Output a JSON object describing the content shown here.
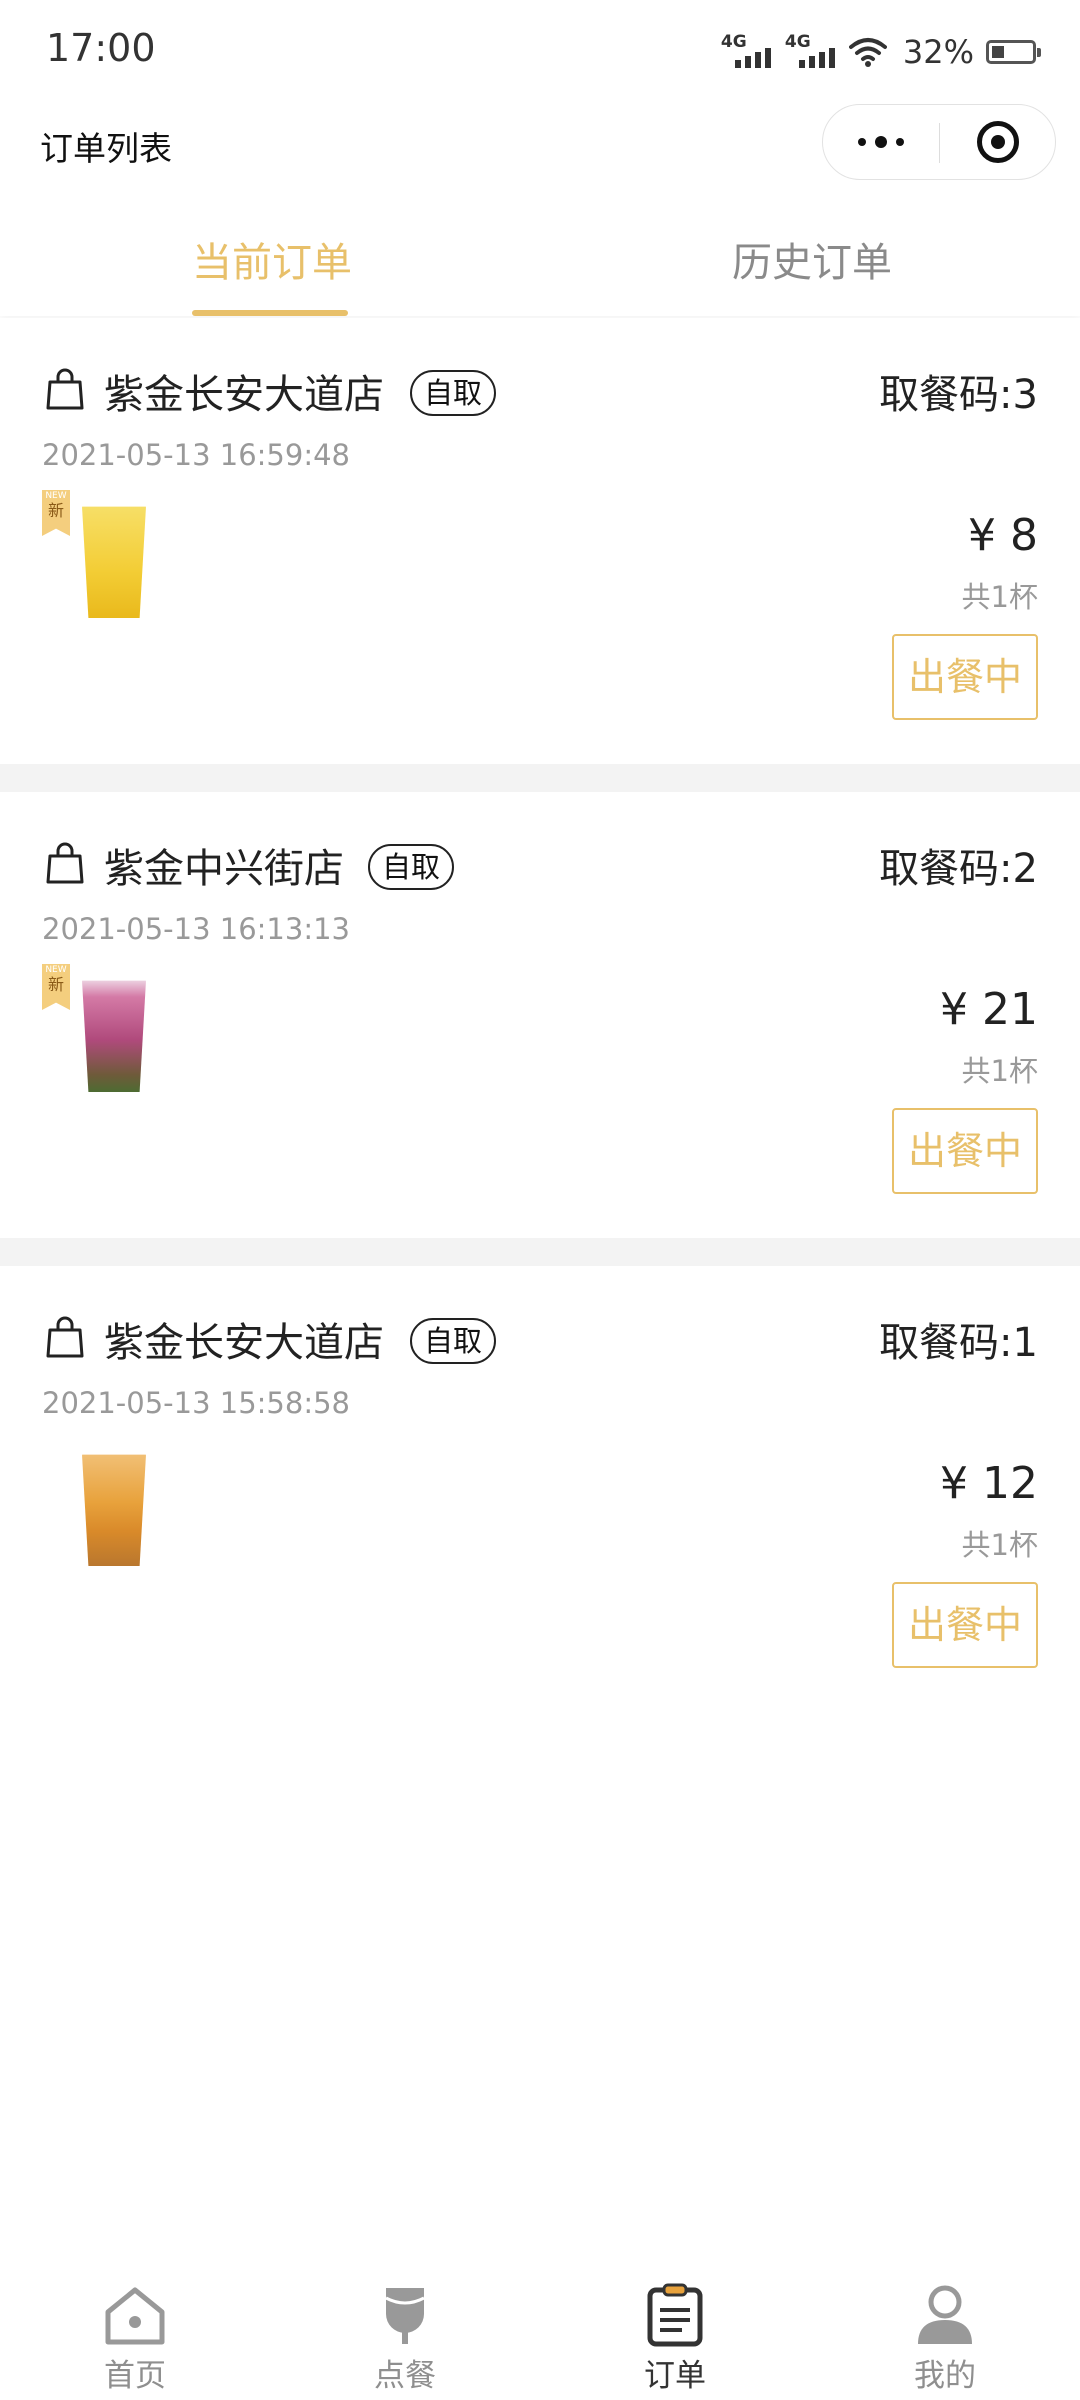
{
  "status_bar": {
    "time": "17:00",
    "signal_1": "4G",
    "signal_2": "4G",
    "battery": "32%",
    "battery_level": 0.32
  },
  "nav": {
    "title": "订单列表"
  },
  "tabs": [
    {
      "label": "当前订单",
      "active": true
    },
    {
      "label": "历史订单",
      "active": false
    }
  ],
  "orders": [
    {
      "store": "紫金长安大道店",
      "badge": "自取",
      "pickup_code": "取餐码:3",
      "time": "2021-05-13 16:59:48",
      "new_tag": "新",
      "price": "¥ 8",
      "count": "共1杯",
      "status": "出餐中",
      "drink_color": "#f3cd35"
    },
    {
      "store": "紫金中兴街店",
      "badge": "自取",
      "pickup_code": "取餐码:2",
      "time": "2021-05-13 16:13:13",
      "new_tag": "新",
      "price": "¥ 21",
      "count": "共1杯",
      "status": "出餐中",
      "drink_color": "#b04a7c"
    },
    {
      "store": "紫金长安大道店",
      "badge": "自取",
      "pickup_code": "取餐码:1",
      "time": "2021-05-13 15:58:58",
      "new_tag": "",
      "price": "¥ 12",
      "count": "共1杯",
      "status": "出餐中",
      "drink_color": "#e8a23c"
    }
  ],
  "tabbar": [
    {
      "label": "首页",
      "icon": "home-icon",
      "active": false
    },
    {
      "label": "点餐",
      "icon": "drink-icon",
      "active": false
    },
    {
      "label": "订单",
      "icon": "order-icon",
      "active": true
    },
    {
      "label": "我的",
      "icon": "profile-icon",
      "active": false
    }
  ],
  "colors": {
    "accent": "#e8c06a",
    "muted": "#999999"
  }
}
